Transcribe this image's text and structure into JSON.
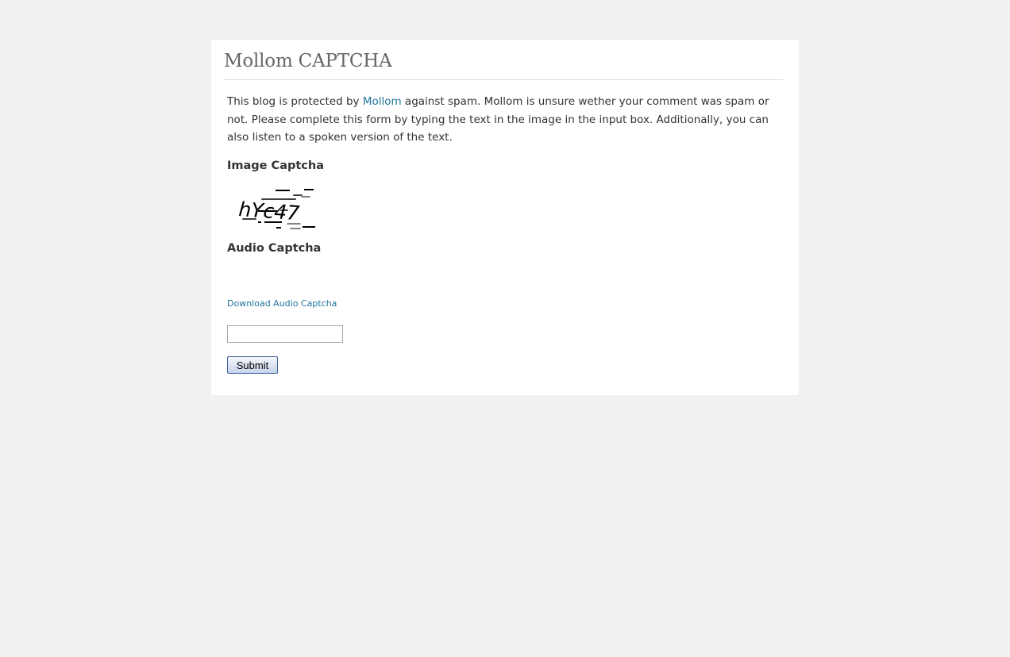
{
  "title": "Mollom CAPTCHA",
  "intro": {
    "before_link": "This blog is protected by ",
    "link": "Mollom",
    "after_link": " against spam. Mollom is unsure wether your comment was spam or not. Please complete this form by typing the text in the image in the input box. Additionally, you can also listen to a spoken version of the text."
  },
  "image_captcha": {
    "heading": "Image Captcha",
    "text": "hYc47"
  },
  "audio_captcha": {
    "heading": "Audio Captcha",
    "download_link": "Download Audio Captcha"
  },
  "form": {
    "input_value": "",
    "submit_label": "Submit"
  },
  "colors": {
    "background": "#f1f1f1",
    "panel": "#ffffff",
    "link": "#21759b",
    "title": "#666666"
  }
}
